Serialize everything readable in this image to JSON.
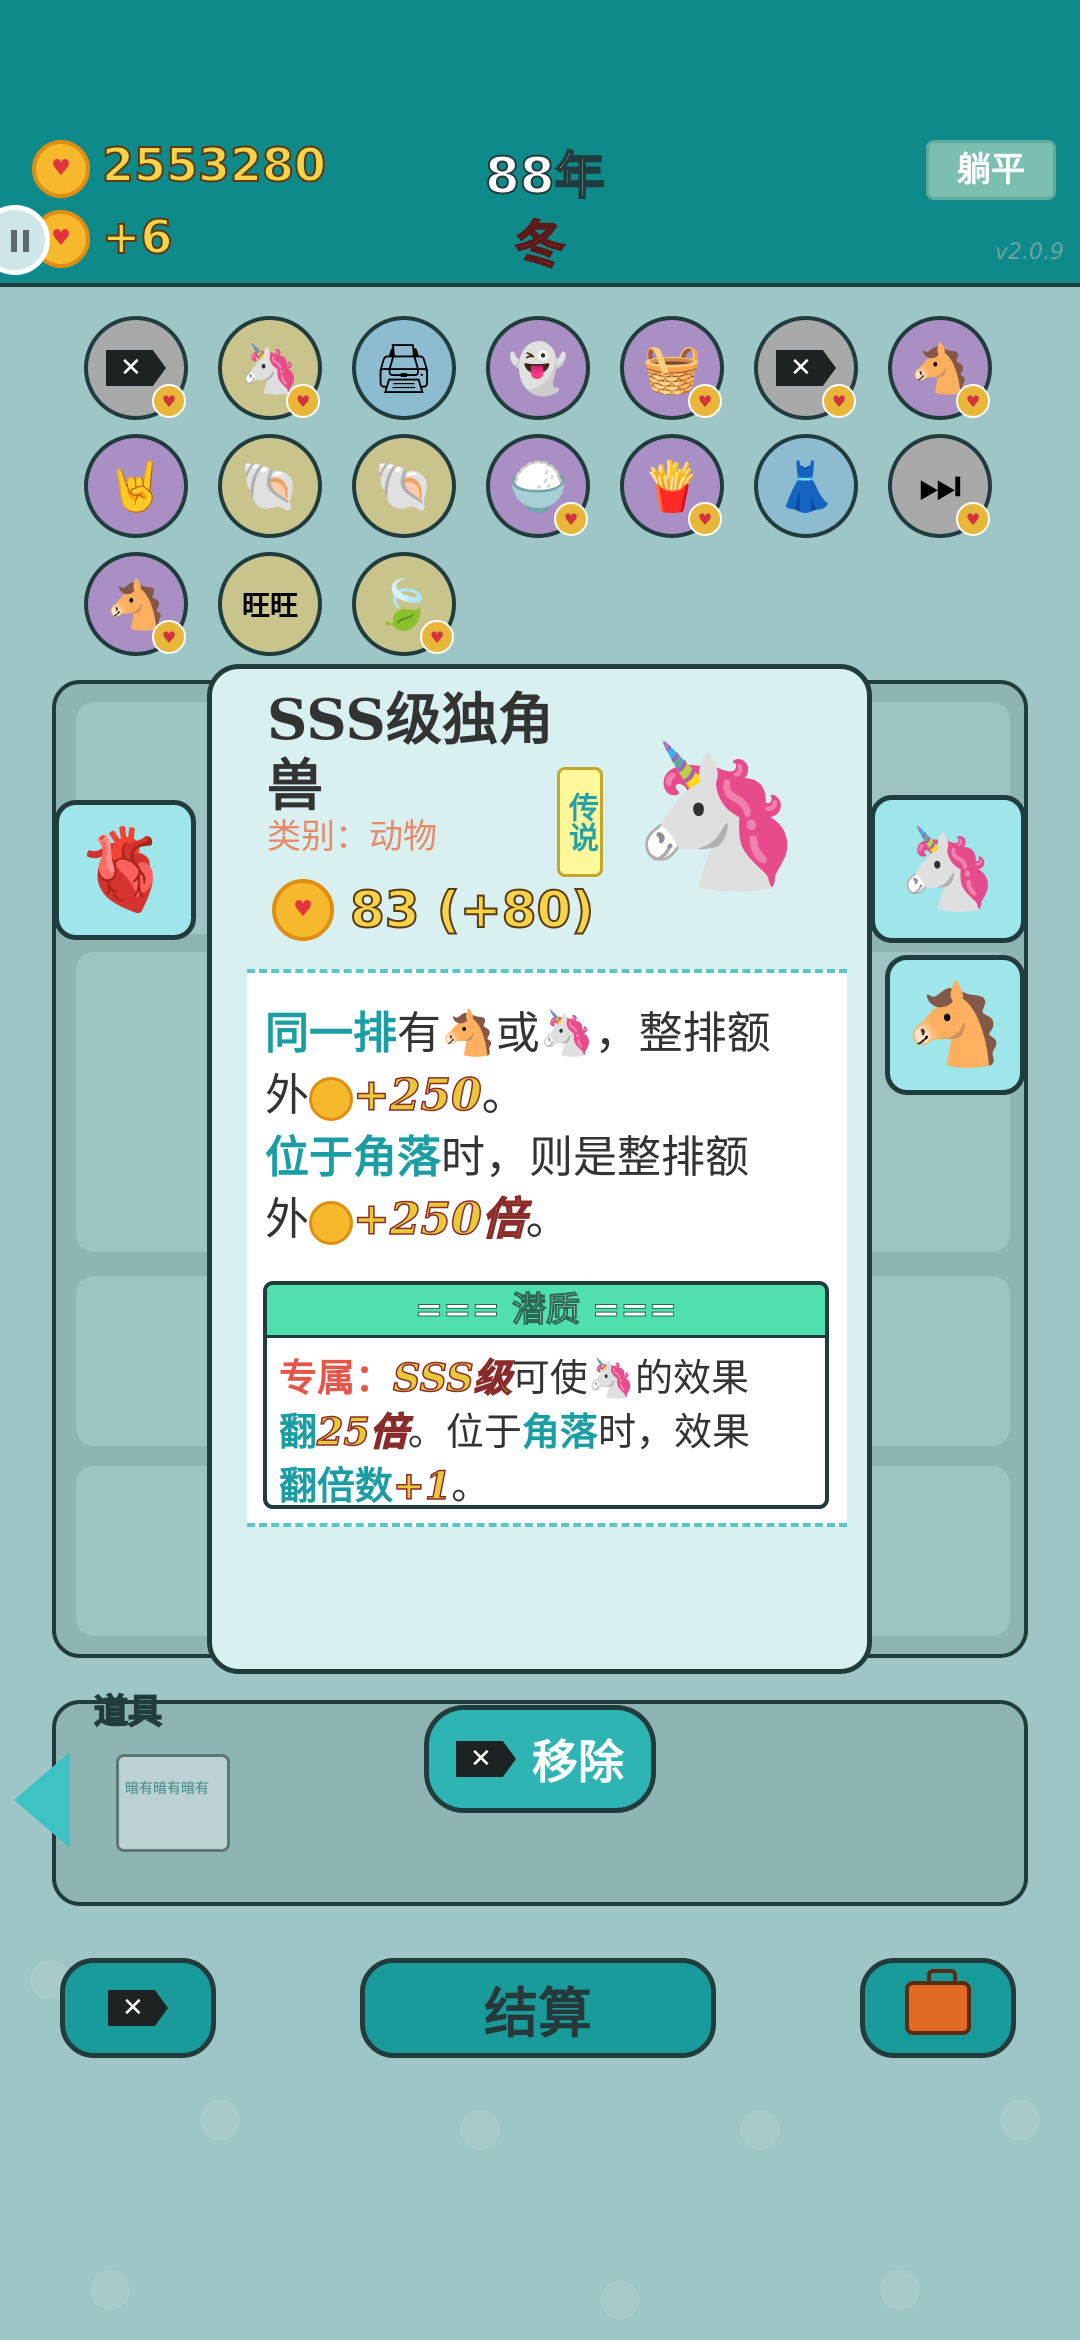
{
  "header": {
    "coins": "2553280",
    "coin_delta": "+6",
    "year": "88年",
    "season": "冬",
    "lie_flat_label": "躺平",
    "version": "v2.0.9"
  },
  "items_row1": [
    "remove",
    "unicorn",
    "printer",
    "ghost",
    "basket",
    "remove",
    "unicorn-pair"
  ],
  "items_row2": [
    "rock-hand",
    "shell",
    "shell",
    "rice",
    "fries",
    "skirt",
    "skip"
  ],
  "items_row3": [
    "unicorn-pair",
    "wang-tiles",
    "leaf"
  ],
  "card": {
    "title": "SSS级独角兽",
    "type_label": "类别：动物",
    "rarity": "传说",
    "value": "83 (+80)",
    "desc1_a": "同一排",
    "desc1_b": "有",
    "desc1_c": "或",
    "desc1_d": "，整排额",
    "desc2_a": "外",
    "desc2_bonus": "+250",
    "desc2_end": "。",
    "desc3_a": "位于角落",
    "desc3_b": "时，则是整排额",
    "desc4_a": "外",
    "desc4_bonus": "+250倍",
    "desc4_end": "。",
    "latent_title": "=== 潜质 ===",
    "latent1_a": "专属：",
    "latent1_b": "SSS级",
    "latent1_c": "可使",
    "latent1_d": "的效果",
    "latent2_a": "翻",
    "latent2_b": "25倍",
    "latent2_c": "。位于",
    "latent2_d": "角落",
    "latent2_e": "时，效果",
    "latent3_a": "翻倍数",
    "latent3_b": "+1",
    "latent3_c": "。"
  },
  "props": {
    "label": "道具",
    "item_text": "暗有暗有暗有"
  },
  "buttons": {
    "remove_label": "移除",
    "settle_label": "结算"
  }
}
